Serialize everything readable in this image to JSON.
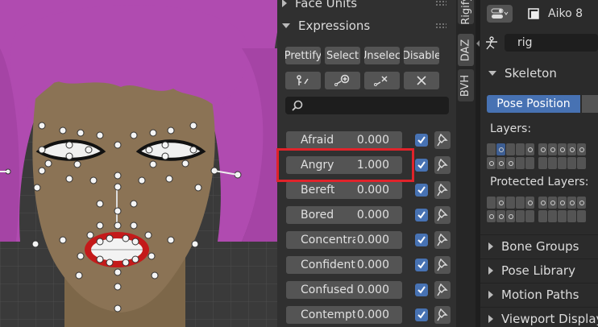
{
  "sidebar_tabs": [
    "Rigify",
    "DAZ",
    "BVH"
  ],
  "panel": {
    "face_units_label": "Face Units",
    "expressions_label": "Expressions",
    "buttons": [
      "Prettify",
      "Select",
      "Unselect",
      "Disable"
    ],
    "icon_buttons": [
      "bone-key-icon",
      "add-bone-icon",
      "remove-bone-icon",
      "close-icon"
    ],
    "search_placeholder": ""
  },
  "expressions": [
    {
      "name": "Afraid",
      "value": "0.000",
      "checked": true
    },
    {
      "name": "Angry",
      "value": "1.000",
      "checked": true
    },
    {
      "name": "Bereft",
      "value": "0.000",
      "checked": true
    },
    {
      "name": "Bored",
      "value": "0.000",
      "checked": true
    },
    {
      "name": "Concentrating",
      "value": "0.000",
      "checked": true
    },
    {
      "name": "Confident",
      "value": "0.000",
      "checked": true
    },
    {
      "name": "Confused",
      "value": "0.000",
      "checked": true
    },
    {
      "name": "Contempt",
      "value": "0.000",
      "checked": true
    }
  ],
  "properties": {
    "object_name": "Aiko 8",
    "data_name": "rig",
    "skeleton_label": "Skeleton",
    "pose_position_label": "Pose Position",
    "layers_label": "Layers:",
    "protected_layers_label": "Protected Layers:",
    "subpanels": [
      "Bone Groups",
      "Pose Library",
      "Motion Paths",
      "Viewport Display"
    ]
  },
  "colors": {
    "accent": "#4772b3",
    "highlight": "#e0232a",
    "hair": "#b04bb0",
    "skin": "#8b7355"
  }
}
